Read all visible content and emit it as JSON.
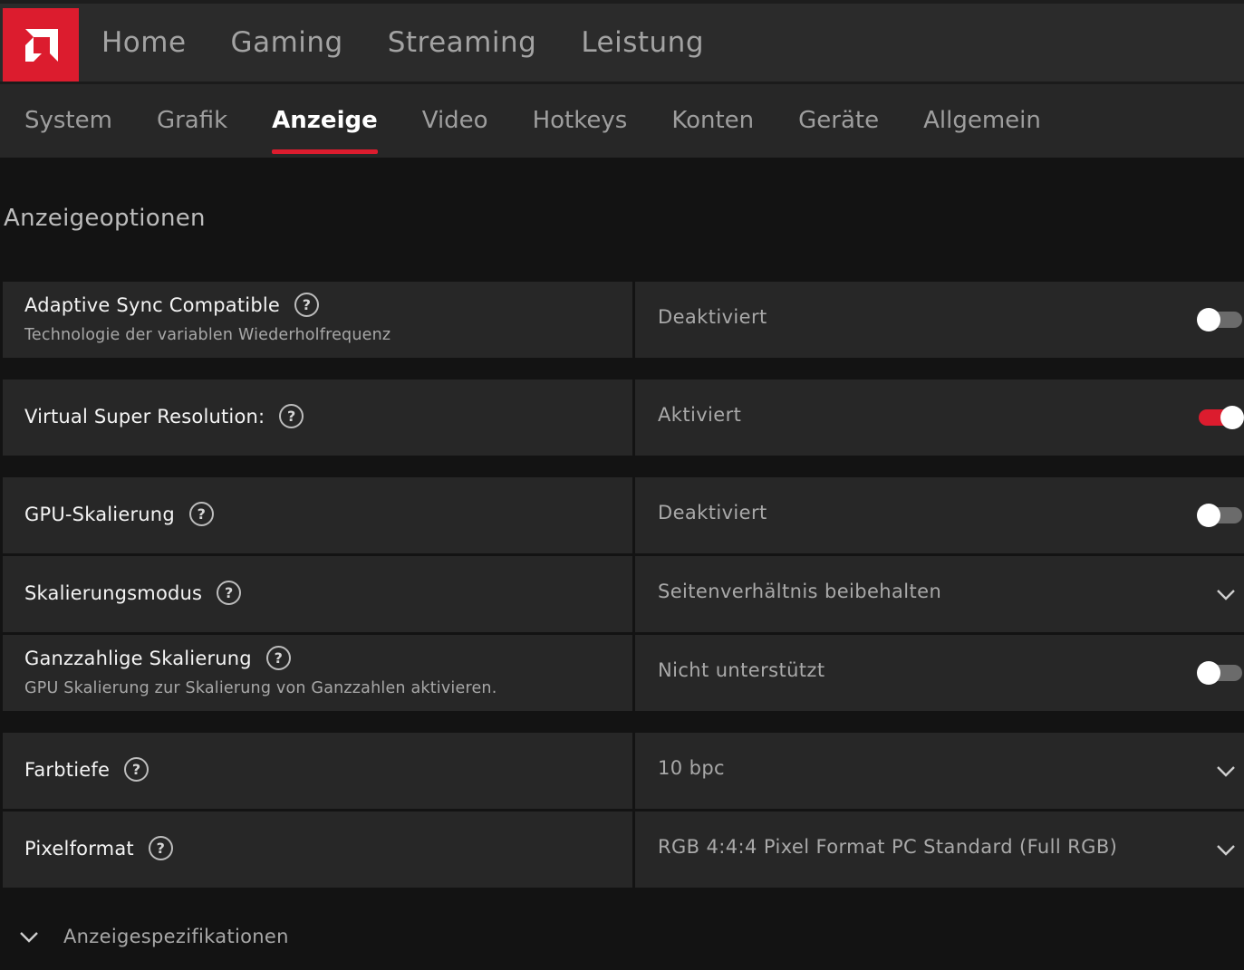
{
  "colors": {
    "accent": "#dc1c2e",
    "panel": "#272727",
    "background": "#131313"
  },
  "logo_icon": "amd-logo-icon",
  "top_nav": [
    "Home",
    "Gaming",
    "Streaming",
    "Leistung"
  ],
  "sub_nav": {
    "items": [
      "System",
      "Grafik",
      "Anzeige",
      "Video",
      "Hotkeys",
      "Konten",
      "Geräte",
      "Allgemein"
    ],
    "active": "Anzeige"
  },
  "section_title": "Anzeigeoptionen",
  "settings": {
    "adaptive_sync": {
      "label": "Adaptive Sync Compatible",
      "description": "Technologie der variablen Wiederholfrequenz",
      "value": "Deaktiviert",
      "toggle": "off"
    },
    "vsr": {
      "label": "Virtual Super Resolution:",
      "value": "Aktiviert",
      "toggle": "on"
    },
    "gpu_scaling": {
      "label": "GPU-Skalierung",
      "value": "Deaktiviert",
      "toggle": "off"
    },
    "scaling_mode": {
      "label": "Skalierungsmodus",
      "value": "Seitenverhältnis beibehalten"
    },
    "integer_scaling": {
      "label": "Ganzzahlige Skalierung",
      "description": "GPU Skalierung zur Skalierung von Ganzzahlen aktivieren.",
      "value": "Nicht unterstützt",
      "toggle": "off"
    },
    "color_depth": {
      "label": "Farbtiefe",
      "value": "10 bpc"
    },
    "pixel_format": {
      "label": "Pixelformat",
      "value": "RGB 4:4:4 Pixel Format PC Standard (Full RGB)"
    }
  },
  "help_glyph": "?",
  "display_specs": {
    "label": "Anzeigespezifikationen"
  }
}
